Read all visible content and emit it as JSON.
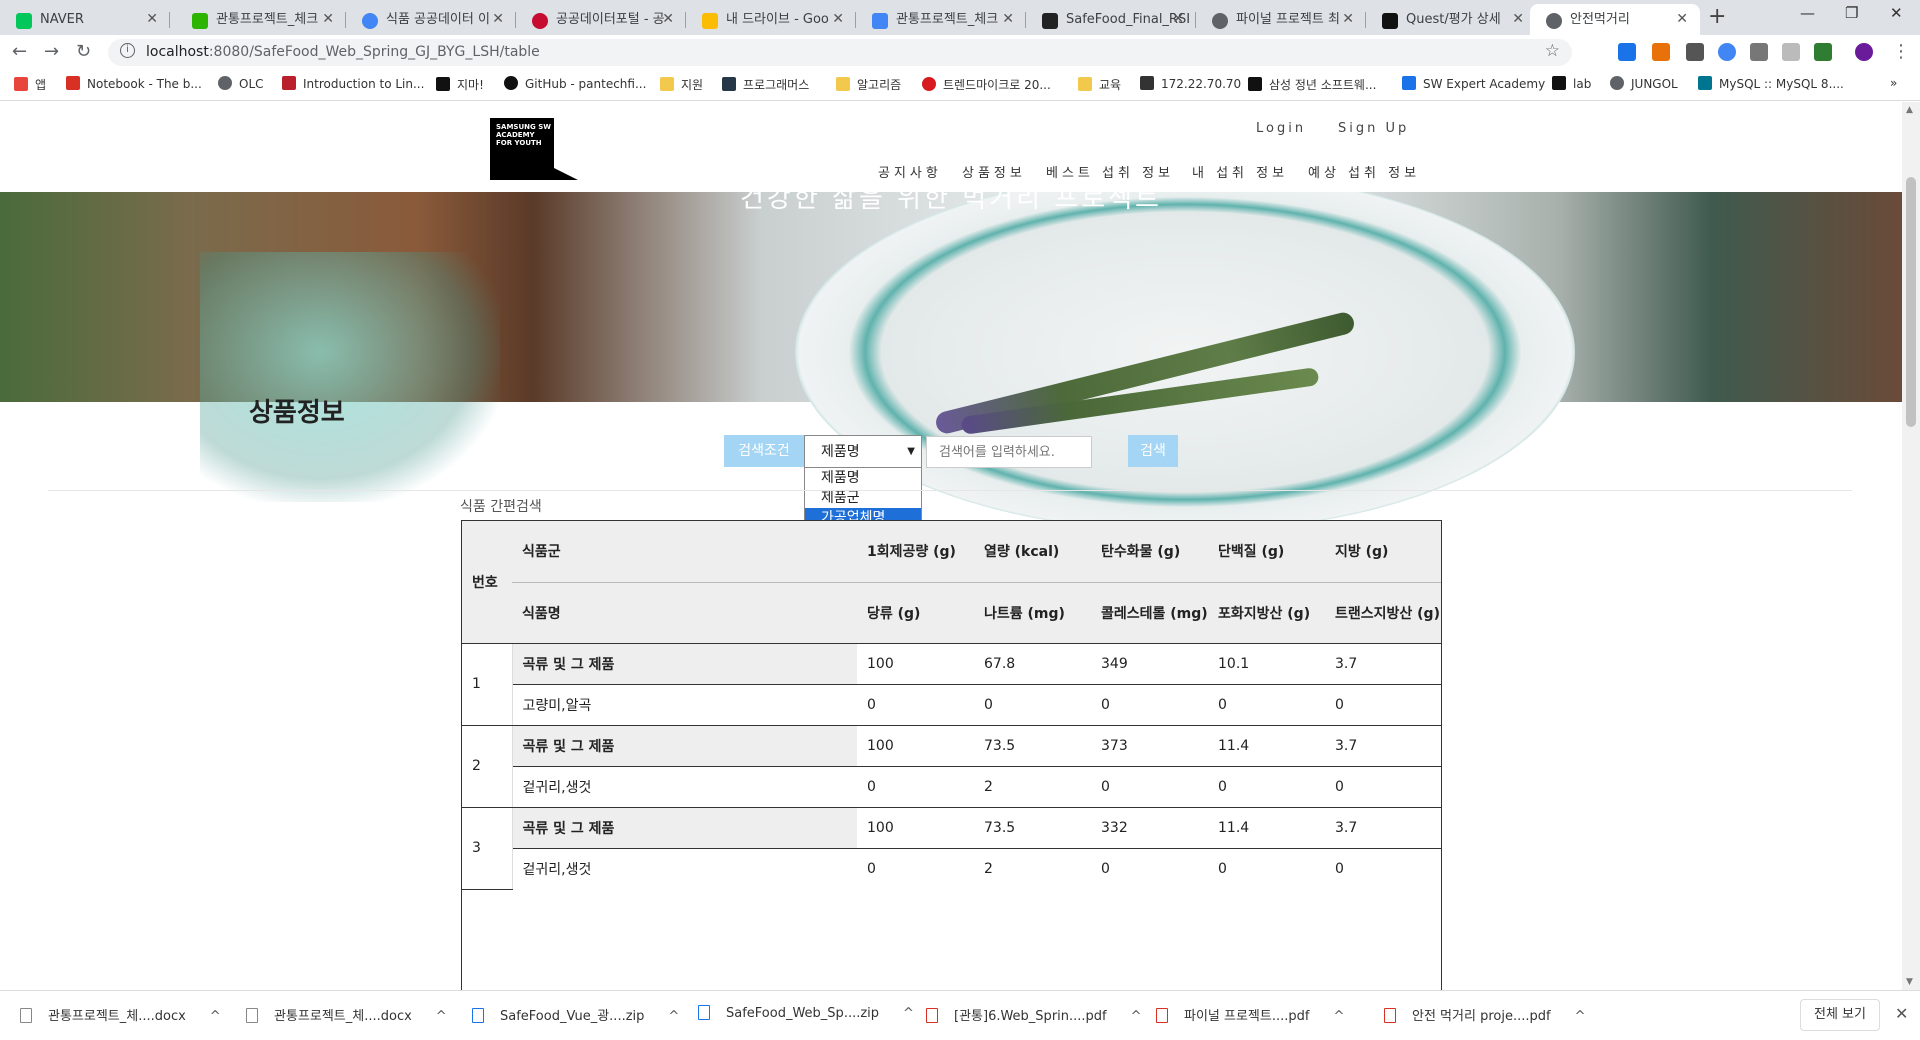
{
  "browser": {
    "tabs": [
      {
        "title": "NAVER",
        "color": "#03c75a"
      },
      {
        "title": "관통프로젝트_체크",
        "color": "#2db400"
      },
      {
        "title": "식품 공공데이터 이",
        "color": "#4285f4"
      },
      {
        "title": "공공데이터포털 - 공",
        "color": "#c60c30"
      },
      {
        "title": "내 드라이브 - Goo",
        "color": "#fbbc04"
      },
      {
        "title": "관통프로젝트_체크",
        "color": "#4285f4"
      },
      {
        "title": "SafeFood_Final_RSI",
        "color": "#222222"
      },
      {
        "title": "파이널 프로젝트 최",
        "color": "#5f6368"
      },
      {
        "title": "Quest/평가 상세",
        "color": "#111111"
      },
      {
        "title": "안전먹거리",
        "color": "#5f6368",
        "active": true
      }
    ],
    "url_host": "localhost",
    "url_path": ":8080/SafeFood_Web_Spring_GJ_BYG_LSH/table",
    "bookmarks": [
      {
        "label": "앱",
        "color": "#e8453c"
      },
      {
        "label": "Notebook - The b...",
        "color": "#d93025"
      },
      {
        "label": "OLC",
        "color": "#5f6368"
      },
      {
        "label": "Introduction to Lin...",
        "color": "#b9202b"
      },
      {
        "label": "지마!",
        "color": "#111111"
      },
      {
        "label": "GitHub - pantechfi...",
        "color": "#111111"
      },
      {
        "label": "지원",
        "color": "#f2c94c"
      },
      {
        "label": "프로그래머스",
        "color": "#263747"
      },
      {
        "label": "알고리즘",
        "color": "#f2c94c"
      },
      {
        "label": "트렌드마이크로 20...",
        "color": "#d71920"
      },
      {
        "label": "교육",
        "color": "#f2c94c"
      },
      {
        "label": "172.22.70.70",
        "color": "#333333"
      },
      {
        "label": "삼성 정년 소프트웨...",
        "color": "#111111"
      },
      {
        "label": "SW Expert Academy",
        "color": "#1a73e8"
      },
      {
        "label": "lab",
        "color": "#111111"
      },
      {
        "label": "JUNGOL",
        "color": "#5f6368"
      },
      {
        "label": "MySQL :: MySQL 8....",
        "color": "#00758f"
      }
    ]
  },
  "site": {
    "logo_text": "SAMSUNG SW ACADEMY FOR YOUTH",
    "login": "Login",
    "signup": "Sign Up",
    "nav": [
      "공지사항",
      "상품정보",
      "베스트 섭취 정보",
      "내 섭취 정보",
      "예상 섭취 정보"
    ],
    "hero_text": "건강한 삶을 위한 먹거리 프로젝트"
  },
  "main": {
    "title": "상품정보",
    "search_label": "검색조건",
    "selected_option": "제품명",
    "options": [
      "제품명",
      "제품군",
      "가공업체명"
    ],
    "highlighted_option": "가공업체명",
    "search_placeholder": "검색어를 입력하세요.",
    "search_button": "검색",
    "quick_search": "식품 간편검색"
  },
  "table": {
    "header_no": "번호",
    "header_group": "식품군",
    "header_name": "식품명",
    "header_top": [
      "1회제공량 (g)",
      "열량 (kcal)",
      "탄수화물 (g)",
      "단백질 (g)",
      "지방 (g)"
    ],
    "header_bottom": [
      "당류 (g)",
      "나트륨 (mg)",
      "콜레스테롤 (mg)",
      "포화지방산 (g)",
      "트랜스지방산 (g)"
    ],
    "rows": [
      {
        "no": "1",
        "group": "곡류 및 그 제품",
        "name": "고량미,알곡",
        "top": [
          "100",
          "67.8",
          "349",
          "10.1",
          "3.7"
        ],
        "bottom": [
          "0",
          "0",
          "0",
          "0",
          "0"
        ]
      },
      {
        "no": "2",
        "group": "곡류 및 그 제품",
        "name": "겉귀리,생것",
        "top": [
          "100",
          "73.5",
          "373",
          "11.4",
          "3.7"
        ],
        "bottom": [
          "0",
          "2",
          "0",
          "0",
          "0"
        ]
      },
      {
        "no": "3",
        "group": "곡류 및 그 제품",
        "name": "겉귀리,생것",
        "top": [
          "100",
          "73.5",
          "332",
          "11.4",
          "3.7"
        ],
        "bottom": [
          "0",
          "2",
          "0",
          "0",
          "0"
        ]
      }
    ]
  },
  "downloads": {
    "items": [
      "관통프로젝트_체....docx",
      "관통프로젝트_체....docx",
      "SafeFood_Vue_광....zip",
      "SafeFood_Web_Sp....zip",
      "[관통]6.Web_Sprin....pdf",
      "파이널 프로젝트....pdf",
      "안전 먹거리 proje....pdf"
    ],
    "show_all": "전체 보기"
  }
}
